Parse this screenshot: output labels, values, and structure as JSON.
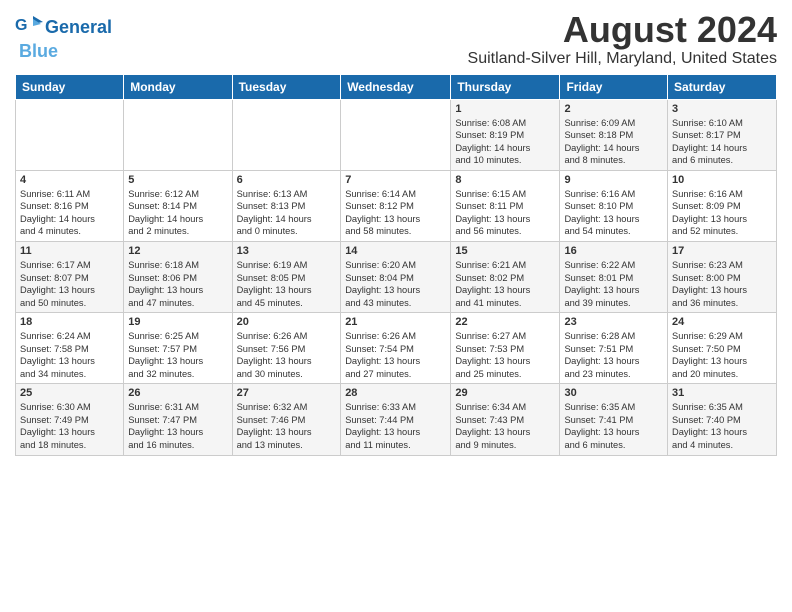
{
  "logo": {
    "line1": "General",
    "line2": "Blue"
  },
  "title": "August 2024",
  "location": "Suitland-Silver Hill, Maryland, United States",
  "weekdays": [
    "Sunday",
    "Monday",
    "Tuesday",
    "Wednesday",
    "Thursday",
    "Friday",
    "Saturday"
  ],
  "weeks": [
    [
      {
        "day": "",
        "info": ""
      },
      {
        "day": "",
        "info": ""
      },
      {
        "day": "",
        "info": ""
      },
      {
        "day": "",
        "info": ""
      },
      {
        "day": "1",
        "info": "Sunrise: 6:08 AM\nSunset: 8:19 PM\nDaylight: 14 hours\nand 10 minutes."
      },
      {
        "day": "2",
        "info": "Sunrise: 6:09 AM\nSunset: 8:18 PM\nDaylight: 14 hours\nand 8 minutes."
      },
      {
        "day": "3",
        "info": "Sunrise: 6:10 AM\nSunset: 8:17 PM\nDaylight: 14 hours\nand 6 minutes."
      }
    ],
    [
      {
        "day": "4",
        "info": "Sunrise: 6:11 AM\nSunset: 8:16 PM\nDaylight: 14 hours\nand 4 minutes."
      },
      {
        "day": "5",
        "info": "Sunrise: 6:12 AM\nSunset: 8:14 PM\nDaylight: 14 hours\nand 2 minutes."
      },
      {
        "day": "6",
        "info": "Sunrise: 6:13 AM\nSunset: 8:13 PM\nDaylight: 14 hours\nand 0 minutes."
      },
      {
        "day": "7",
        "info": "Sunrise: 6:14 AM\nSunset: 8:12 PM\nDaylight: 13 hours\nand 58 minutes."
      },
      {
        "day": "8",
        "info": "Sunrise: 6:15 AM\nSunset: 8:11 PM\nDaylight: 13 hours\nand 56 minutes."
      },
      {
        "day": "9",
        "info": "Sunrise: 6:16 AM\nSunset: 8:10 PM\nDaylight: 13 hours\nand 54 minutes."
      },
      {
        "day": "10",
        "info": "Sunrise: 6:16 AM\nSunset: 8:09 PM\nDaylight: 13 hours\nand 52 minutes."
      }
    ],
    [
      {
        "day": "11",
        "info": "Sunrise: 6:17 AM\nSunset: 8:07 PM\nDaylight: 13 hours\nand 50 minutes."
      },
      {
        "day": "12",
        "info": "Sunrise: 6:18 AM\nSunset: 8:06 PM\nDaylight: 13 hours\nand 47 minutes."
      },
      {
        "day": "13",
        "info": "Sunrise: 6:19 AM\nSunset: 8:05 PM\nDaylight: 13 hours\nand 45 minutes."
      },
      {
        "day": "14",
        "info": "Sunrise: 6:20 AM\nSunset: 8:04 PM\nDaylight: 13 hours\nand 43 minutes."
      },
      {
        "day": "15",
        "info": "Sunrise: 6:21 AM\nSunset: 8:02 PM\nDaylight: 13 hours\nand 41 minutes."
      },
      {
        "day": "16",
        "info": "Sunrise: 6:22 AM\nSunset: 8:01 PM\nDaylight: 13 hours\nand 39 minutes."
      },
      {
        "day": "17",
        "info": "Sunrise: 6:23 AM\nSunset: 8:00 PM\nDaylight: 13 hours\nand 36 minutes."
      }
    ],
    [
      {
        "day": "18",
        "info": "Sunrise: 6:24 AM\nSunset: 7:58 PM\nDaylight: 13 hours\nand 34 minutes."
      },
      {
        "day": "19",
        "info": "Sunrise: 6:25 AM\nSunset: 7:57 PM\nDaylight: 13 hours\nand 32 minutes."
      },
      {
        "day": "20",
        "info": "Sunrise: 6:26 AM\nSunset: 7:56 PM\nDaylight: 13 hours\nand 30 minutes."
      },
      {
        "day": "21",
        "info": "Sunrise: 6:26 AM\nSunset: 7:54 PM\nDaylight: 13 hours\nand 27 minutes."
      },
      {
        "day": "22",
        "info": "Sunrise: 6:27 AM\nSunset: 7:53 PM\nDaylight: 13 hours\nand 25 minutes."
      },
      {
        "day": "23",
        "info": "Sunrise: 6:28 AM\nSunset: 7:51 PM\nDaylight: 13 hours\nand 23 minutes."
      },
      {
        "day": "24",
        "info": "Sunrise: 6:29 AM\nSunset: 7:50 PM\nDaylight: 13 hours\nand 20 minutes."
      }
    ],
    [
      {
        "day": "25",
        "info": "Sunrise: 6:30 AM\nSunset: 7:49 PM\nDaylight: 13 hours\nand 18 minutes."
      },
      {
        "day": "26",
        "info": "Sunrise: 6:31 AM\nSunset: 7:47 PM\nDaylight: 13 hours\nand 16 minutes."
      },
      {
        "day": "27",
        "info": "Sunrise: 6:32 AM\nSunset: 7:46 PM\nDaylight: 13 hours\nand 13 minutes."
      },
      {
        "day": "28",
        "info": "Sunrise: 6:33 AM\nSunset: 7:44 PM\nDaylight: 13 hours\nand 11 minutes."
      },
      {
        "day": "29",
        "info": "Sunrise: 6:34 AM\nSunset: 7:43 PM\nDaylight: 13 hours\nand 9 minutes."
      },
      {
        "day": "30",
        "info": "Sunrise: 6:35 AM\nSunset: 7:41 PM\nDaylight: 13 hours\nand 6 minutes."
      },
      {
        "day": "31",
        "info": "Sunrise: 6:35 AM\nSunset: 7:40 PM\nDaylight: 13 hours\nand 4 minutes."
      }
    ]
  ]
}
